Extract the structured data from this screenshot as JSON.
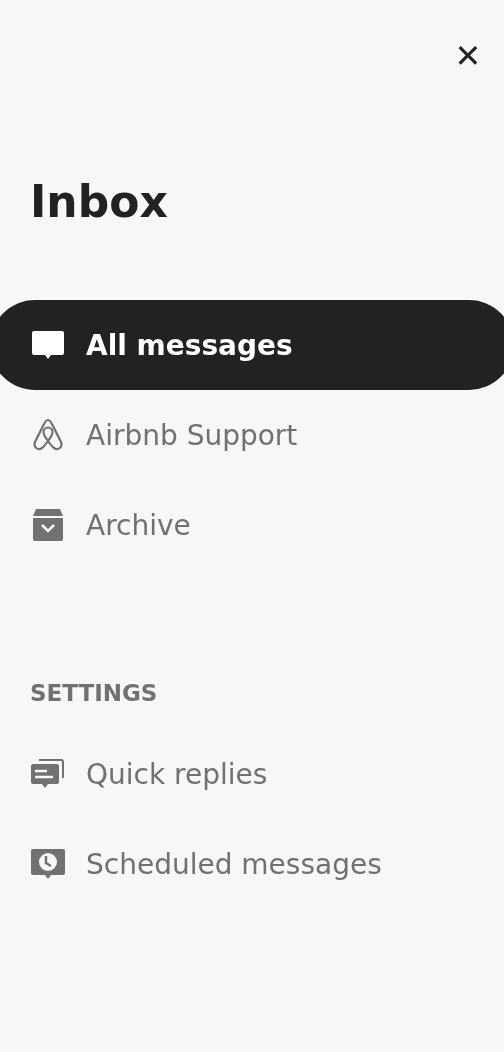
{
  "close_button": {
    "label": "✕"
  },
  "title": "Inbox",
  "nav_items": [
    {
      "label": "All messages",
      "selected": true
    },
    {
      "label": "Airbnb Support",
      "selected": false
    },
    {
      "label": "Archive",
      "selected": false
    }
  ],
  "settings": {
    "heading": "SETTINGS",
    "items": [
      {
        "label": "Quick replies"
      },
      {
        "label": "Scheduled messages"
      }
    ]
  }
}
